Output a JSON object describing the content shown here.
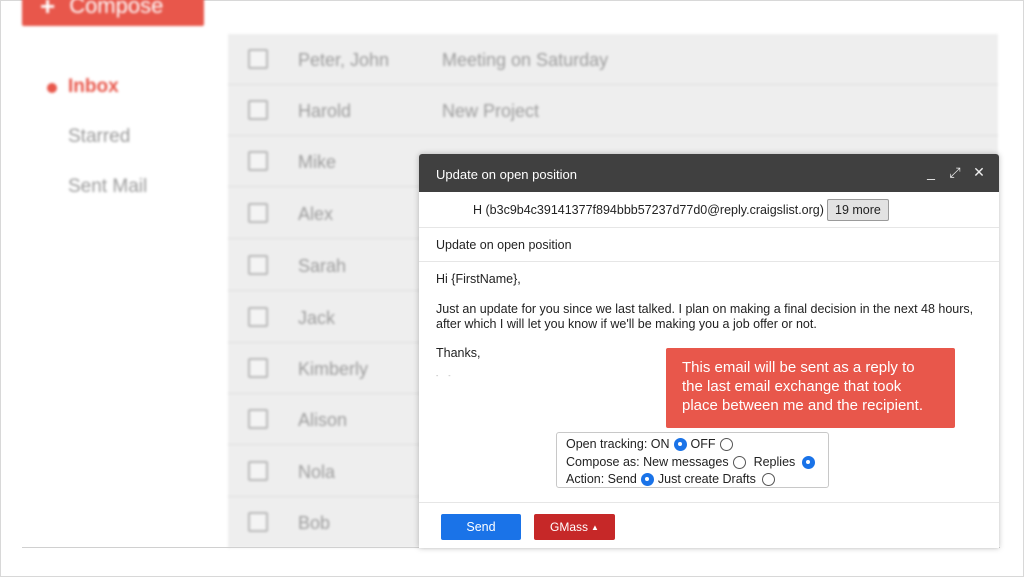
{
  "compose_button": {
    "label": "Compose",
    "icon": "plus-icon"
  },
  "sidebar": {
    "items": [
      {
        "label": "Inbox",
        "active": true
      },
      {
        "label": "Starred",
        "active": false
      },
      {
        "label": "Sent Mail",
        "active": false
      }
    ]
  },
  "email_list": [
    {
      "sender": "Peter, John",
      "subject": "Meeting on Saturday"
    },
    {
      "sender": "Harold",
      "subject": "New Project"
    },
    {
      "sender": "Mike",
      "subject": ""
    },
    {
      "sender": "Alex",
      "subject": ""
    },
    {
      "sender": "Sarah",
      "subject": ""
    },
    {
      "sender": "Jack",
      "subject": ""
    },
    {
      "sender": "Kimberly",
      "subject": ""
    },
    {
      "sender": "Alison",
      "subject": ""
    },
    {
      "sender": "Nola",
      "subject": ""
    },
    {
      "sender": "Bob",
      "subject": ""
    }
  ],
  "compose_window": {
    "title": "Update on open position",
    "controls": {
      "minimize": "_",
      "expand": "⤢",
      "close": "✕"
    },
    "to_address": "H (b3c9b4c39141377f894bbb57237d77d0@reply.craigslist.org)",
    "more_recipients": "19 more",
    "subject": "Update on open position",
    "body": {
      "greeting": "Hi {FirstName},",
      "paragraph": "Just an update for you since we last talked. I plan on making a final decision in the next 48 hours, after which I will let you know if we'll be making you a job offer or not.",
      "closing": "Thanks,",
      "signature": "- -"
    },
    "options": {
      "tracking_label": "Open tracking: ON",
      "tracking_off_label": "OFF",
      "tracking_on": true,
      "compose_as_label": "Compose as: New messages",
      "replies_label": "Replies",
      "compose_as": "Replies",
      "action_label": "Action: Send",
      "drafts_label": "Just create Drafts",
      "action": "Send"
    },
    "send_label": "Send",
    "gmass_label": "GMass",
    "gmass_caret": "▲"
  },
  "callout": {
    "text": "This email will be sent as a reply to the last email exchange that took place between me and the recipient."
  },
  "colors": {
    "accent_red": "#e8574b",
    "send_blue": "#1a73e8",
    "gmass_red": "#c62828",
    "header_dark": "#404040"
  }
}
